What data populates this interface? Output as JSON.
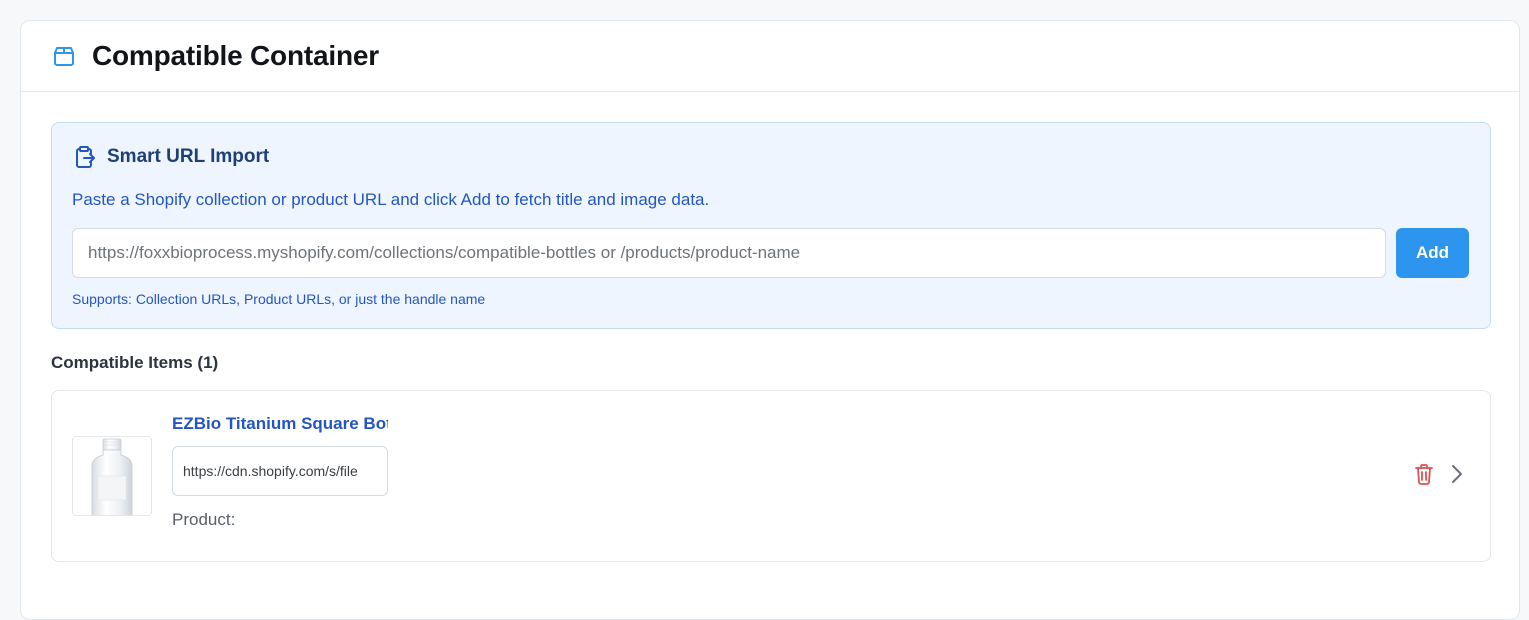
{
  "header": {
    "title": "Compatible Container",
    "icon": "box-icon",
    "accent": "#2d95ee"
  },
  "smart_import": {
    "title": "Smart URL Import",
    "icon": "clipboard-import-icon",
    "description": "Paste a Shopify collection or product URL and click Add to fetch title and image data.",
    "input_placeholder": "https://foxxbioprocess.myshopify.com/collections/compatible-bottles or /products/product-name",
    "input_value": "",
    "add_label": "Add",
    "hint": "Supports: Collection URLs, Product URLs, or just the handle name",
    "panel_bg": "#eef5fe",
    "text_color": "#2456c2"
  },
  "compatible_items": {
    "heading": "Compatible Items (1)",
    "items": [
      {
        "title": "EZBio Titanium Square Bott",
        "image_url": "https://cdn.shopify.com/s/file",
        "product_label": "Product:",
        "thumbnail": "bottle-image"
      }
    ],
    "delete_icon": "trash-icon",
    "expand_icon": "chevron-right-icon",
    "delete_color": "#e05252"
  }
}
